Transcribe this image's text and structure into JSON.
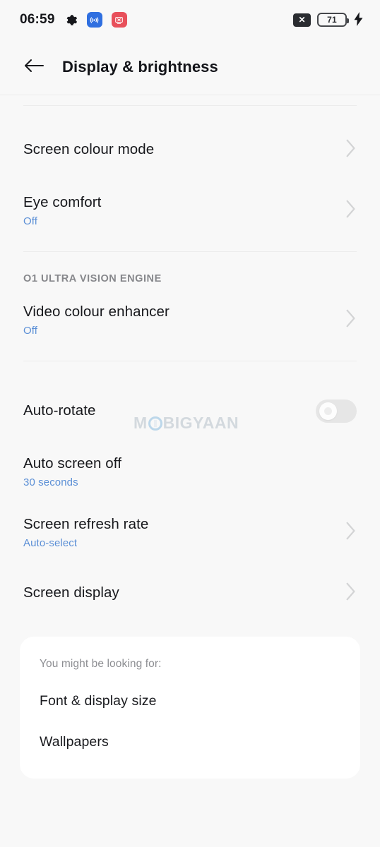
{
  "status_bar": {
    "clock": "06:59",
    "icons": {
      "gear": "gear-icon",
      "broadcast": "broadcast-icon",
      "screencast": "screen-record-icon",
      "mute": "x-badge-icon",
      "bolt": "charging-bolt-icon"
    },
    "mute_glyph": "✕",
    "battery_level": "71",
    "bolt_glyph": "⚡"
  },
  "app_bar": {
    "back_icon": "back-arrow-icon",
    "title": "Display & brightness"
  },
  "settings": {
    "rows": [
      {
        "title": "Screen colour mode",
        "subtitle": "",
        "accessory": "chevron"
      },
      {
        "title": "Eye comfort",
        "subtitle": "Off",
        "accessory": "chevron"
      }
    ],
    "section_label": "O1 ULTRA VISION ENGINE",
    "section_rows": [
      {
        "title": "Video colour enhancer",
        "subtitle": "Off",
        "accessory": "chevron"
      }
    ],
    "rows2": [
      {
        "title": "Auto-rotate",
        "subtitle": "",
        "accessory": "toggle",
        "toggle_state": "off"
      },
      {
        "title": "Auto screen off",
        "subtitle": "30 seconds",
        "accessory": "none"
      },
      {
        "title": "Screen refresh rate",
        "subtitle": "Auto-select",
        "accessory": "chevron"
      },
      {
        "title": "Screen display",
        "subtitle": "",
        "accessory": "chevron"
      }
    ]
  },
  "suggestion_card": {
    "caption": "You might be looking for:",
    "items": [
      {
        "label": "Font & display size"
      },
      {
        "label": "Wallpapers"
      }
    ]
  },
  "watermark": {
    "prefix": "M",
    "mid": "O",
    "suffix": "BIGYAAN"
  },
  "colors": {
    "page_background": "#f8f8f8",
    "card_background": "#ffffff",
    "primary_text": "#17181c",
    "secondary_text": "#8d8e92",
    "accent_blue": "#5b8fd6",
    "divider": "#ececec",
    "chip_blue": "#2f6fe0",
    "chip_red": "#e8505b"
  }
}
